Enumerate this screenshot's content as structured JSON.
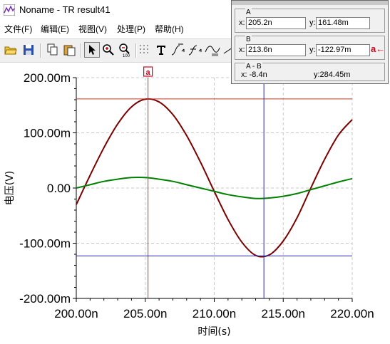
{
  "window": {
    "title": "Noname - TR result41"
  },
  "menu": [
    "文件(F)",
    "编辑(E)",
    "视图(V)",
    "处理(P)",
    "帮助(H)"
  ],
  "toolbar": {
    "buttons": [
      "open-icon",
      "save-icon",
      "copy-icon",
      "paste-icon",
      "pointer-icon",
      "zoom-in-icon",
      "zoom-out-icon",
      "grid-icon",
      "text-icon",
      "cursor-a-icon",
      "cursor-b-icon",
      "curve-icon",
      "line-icon"
    ],
    "zoom_out_badge": "100"
  },
  "cursor_panel": {
    "a": {
      "title": "A",
      "x_label": "x:",
      "x": "205.2n",
      "y_label": "y:",
      "y": "161.48m"
    },
    "b": {
      "title": "B",
      "x_label": "x:",
      "x": "213.6n",
      "y_label": "y:",
      "y": "-122.97m",
      "swap_label": "a←"
    },
    "diff": {
      "title": "A - B",
      "x": "x: -8.4n",
      "y": "y:284.45m"
    }
  },
  "chart_data": {
    "type": "line",
    "ylabel": "电压(V)",
    "xlabel": "时间(s)",
    "xlim": [
      200,
      220
    ],
    "ylim": [
      -200,
      200
    ],
    "x_unit": "n",
    "x_ticks": [
      "200.00n",
      "205.00n",
      "210.00n",
      "215.00n",
      "220.00n"
    ],
    "y_ticks": [
      "200.00m",
      "100.00m",
      "0.00",
      "-100.00m",
      "-200.00m"
    ],
    "grid": true,
    "series": [
      {
        "color": "#7a0000",
        "x": [
          200,
          201,
          202,
          203,
          204,
          205,
          206,
          207,
          208,
          209,
          210,
          211,
          212,
          213,
          214,
          215,
          216,
          217,
          218,
          219,
          220
        ],
        "values": [
          -30,
          23,
          73,
          116,
          147,
          161,
          156,
          133,
          95,
          47,
          -6,
          -57,
          -98,
          -122,
          -121,
          -96,
          -54,
          0,
          52,
          96,
          124
        ]
      },
      {
        "color": "#008000",
        "x": [
          200,
          201,
          202,
          203,
          204,
          205,
          206,
          207,
          208,
          209,
          210,
          211,
          212,
          213,
          214,
          215,
          216,
          217,
          218,
          219,
          220
        ],
        "values": [
          0,
          6,
          12,
          16,
          19,
          19,
          16,
          12,
          6,
          0,
          -6,
          -12,
          -16,
          -19,
          -18,
          -15,
          -10,
          -3,
          4,
          11,
          17
        ]
      }
    ],
    "cursors": [
      {
        "name": "a",
        "x": 205.2,
        "y": 161.48,
        "color": "#c0392b"
      },
      {
        "name": "b",
        "x": 213.6,
        "y": -122.97,
        "color": "#2a2aa8"
      }
    ],
    "cursor_marker_label": "a"
  }
}
